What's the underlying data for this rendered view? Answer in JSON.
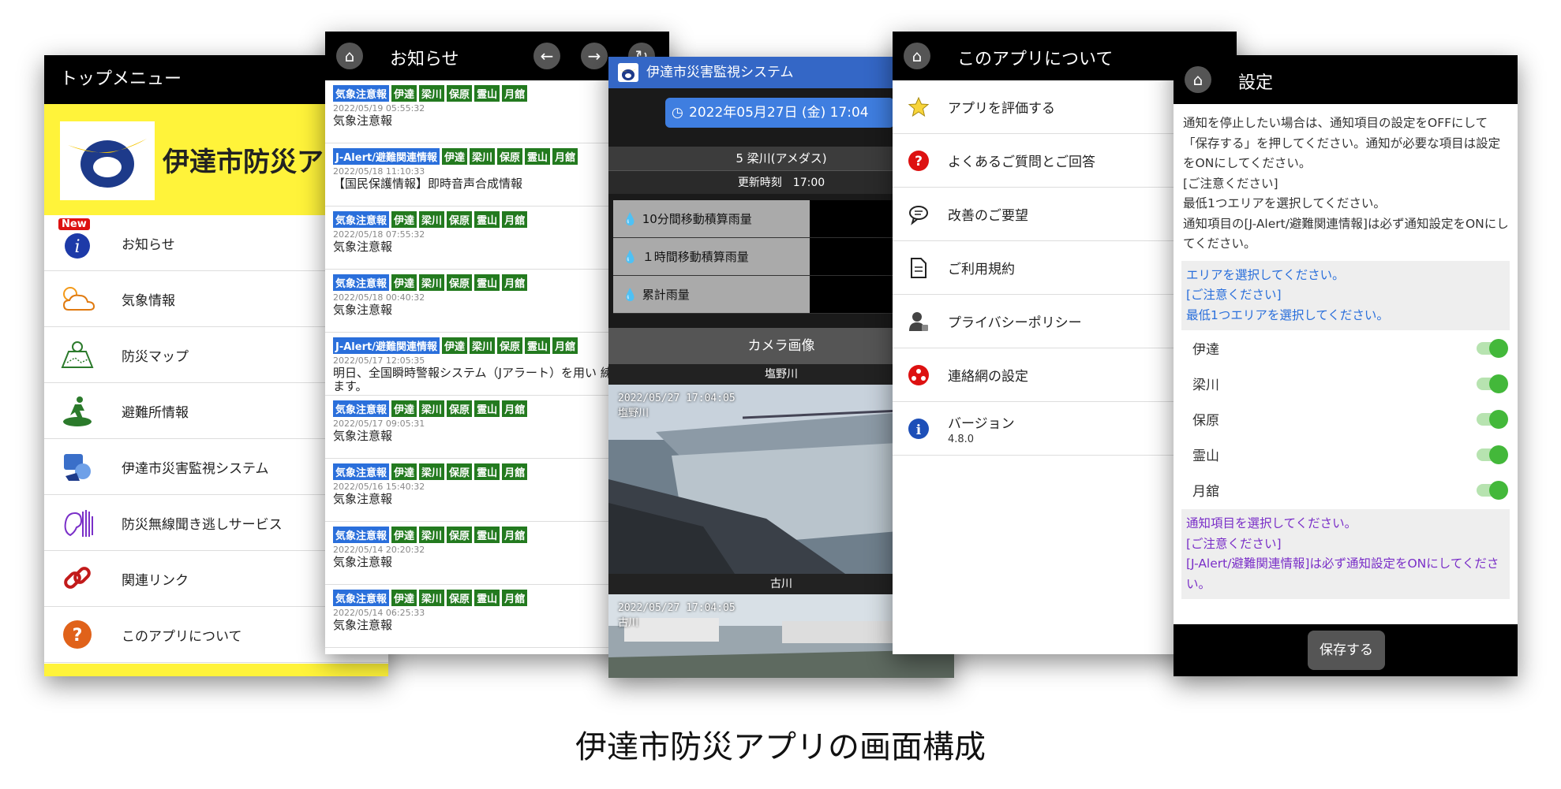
{
  "caption": "伊達市防災アプリの画面構成",
  "top_menu": {
    "title": "トップメニュー",
    "banner_title": "伊達市防災ア",
    "new_badge": "New",
    "items": [
      {
        "label": "お知らせ",
        "icon": "info-icon"
      },
      {
        "label": "気象情報",
        "icon": "weather-icon"
      },
      {
        "label": "防災マップ",
        "icon": "map-icon"
      },
      {
        "label": "避難所情報",
        "icon": "evacuation-icon"
      },
      {
        "label": "伊達市災害監視システム",
        "icon": "monitor-icon"
      },
      {
        "label": "防災無線聞き逃しサービス",
        "icon": "ear-icon"
      },
      {
        "label": "関連リンク",
        "icon": "link-icon"
      },
      {
        "label": "このアプリについて",
        "icon": "question-icon"
      }
    ]
  },
  "notices": {
    "title": "お知らせ",
    "items": [
      {
        "tag": "気象注意報",
        "areas": [
          "伊達",
          "梁川",
          "保原",
          "霊山",
          "月舘"
        ],
        "date": "2022/05/19 05:55:32",
        "text": "気象注意報"
      },
      {
        "tag": "J-Alert/避難関連情報",
        "areas": [
          "伊達",
          "梁川",
          "保原",
          "霊山",
          "月舘"
        ],
        "date": "2022/05/18 11:10:33",
        "text": "【国民保護情報】即時音声合成情報"
      },
      {
        "tag": "気象注意報",
        "areas": [
          "伊達",
          "梁川",
          "保原",
          "霊山",
          "月舘"
        ],
        "date": "2022/05/18 07:55:32",
        "text": "気象注意報"
      },
      {
        "tag": "気象注意報",
        "areas": [
          "伊達",
          "梁川",
          "保原",
          "霊山",
          "月舘"
        ],
        "date": "2022/05/18 00:40:32",
        "text": "気象注意報"
      },
      {
        "tag": "J-Alert/避難関連情報",
        "areas": [
          "伊達",
          "梁川",
          "保原",
          "霊山",
          "月舘"
        ],
        "date": "2022/05/17 12:05:35",
        "text": "明日、全国瞬時警報システム（Jアラート）を用い 練が行われます。"
      },
      {
        "tag": "気象注意報",
        "areas": [
          "伊達",
          "梁川",
          "保原",
          "霊山",
          "月舘"
        ],
        "date": "2022/05/17 09:05:31",
        "text": "気象注意報"
      },
      {
        "tag": "気象注意報",
        "areas": [
          "伊達",
          "梁川",
          "保原",
          "霊山",
          "月舘"
        ],
        "date": "2022/05/16 15:40:32",
        "text": "気象注意報"
      },
      {
        "tag": "気象注意報",
        "areas": [
          "伊達",
          "梁川",
          "保原",
          "霊山",
          "月舘"
        ],
        "date": "2022/05/14 20:20:32",
        "text": "気象注意報"
      },
      {
        "tag": "気象注意報",
        "areas": [
          "伊達",
          "梁川",
          "保原",
          "霊山",
          "月舘"
        ],
        "date": "2022/05/14 06:25:33",
        "text": "気象注意報"
      }
    ]
  },
  "monitor": {
    "title": "伊達市災害監視システム",
    "date": "2022年05月27日 (金) 17:04",
    "station": "5 梁川(アメダス)",
    "updated": "更新時刻　17:00",
    "rain_rows": [
      "10分間移動積算雨量",
      "１時間移動積算雨量",
      "累計雨量"
    ],
    "camera_header": "カメラ画像",
    "cameras": [
      {
        "name": "塩野川",
        "timestamp": "2022/05/27 17:04:05",
        "overlay": "塩野川"
      },
      {
        "name": "古川",
        "timestamp": "2022/05/27 17:04:05",
        "overlay": "古川"
      }
    ]
  },
  "about": {
    "title": "このアプリについて",
    "items": [
      {
        "label": "アプリを評価する",
        "icon": "star-icon"
      },
      {
        "label": "よくあるご質問とご回答",
        "icon": "question-icon"
      },
      {
        "label": "改善のご要望",
        "icon": "chat-icon"
      },
      {
        "label": "ご利用規約",
        "icon": "document-icon"
      },
      {
        "label": "プライバシーポリシー",
        "icon": "privacy-icon"
      },
      {
        "label": "連絡網の設定",
        "icon": "contact-icon"
      },
      {
        "label": "バージョン",
        "sub": "4.8.0",
        "icon": "info-icon"
      }
    ]
  },
  "settings": {
    "title": "設定",
    "intro": "通知を停止したい場合は、通知項目の設定をOFFにして「保存する」を押してください。通知が必要な項目は設定をONにしてください。\n[ご注意ください]\n最低1つエリアを選択してください。\n通知項目の[J-Alert/避難関連情報]は必ず通知設定をONにしてください。",
    "area_info": "エリアを選択してください。\n[ご注意ください]\n最低1つエリアを選択してください。",
    "areas": [
      "伊達",
      "梁川",
      "保原",
      "霊山",
      "月舘"
    ],
    "notify_info": "通知項目を選択してください。\n[ご注意ください]\n[J-Alert/避難関連情報]は必ず通知設定をONにしてください。",
    "save_label": "保存する"
  },
  "colors": {
    "yellow": "#fff33a",
    "tag_blue": "#2a6fdb",
    "tag_green": "#237a1f",
    "toggle_green": "#43b83a"
  }
}
